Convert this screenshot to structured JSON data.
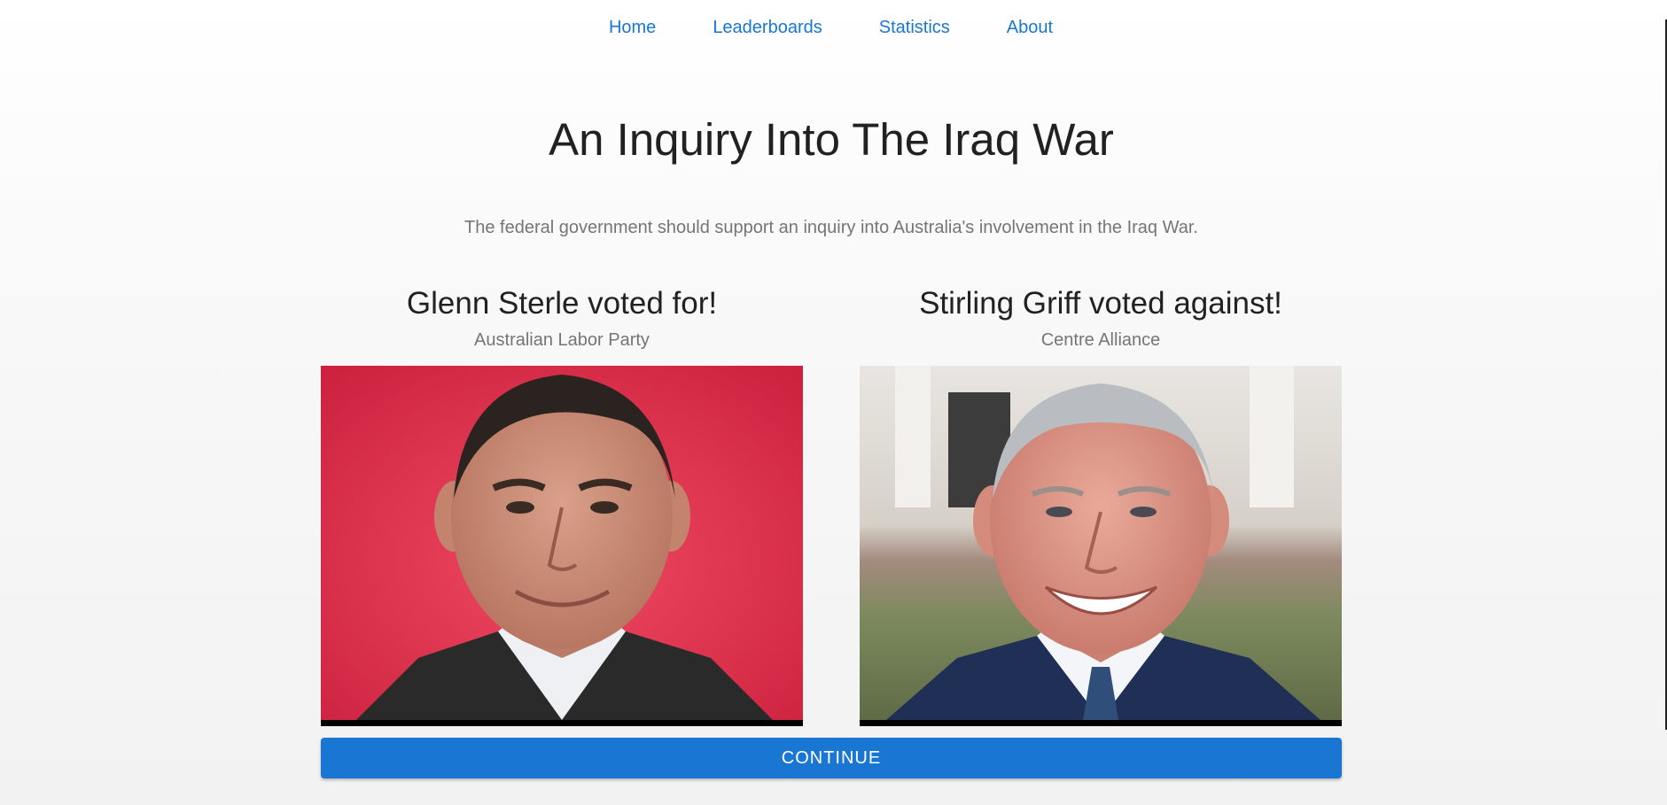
{
  "nav": {
    "items": [
      {
        "label": "Home"
      },
      {
        "label": "Leaderboards"
      },
      {
        "label": "Statistics"
      },
      {
        "label": "About"
      }
    ]
  },
  "vote": {
    "title": "An Inquiry Into The Iraq War",
    "question": "The federal government should support an inquiry into Australia's involvement in the Iraq War."
  },
  "politicians": [
    {
      "heading": "Glenn Sterle voted for!",
      "party": "Australian Labor Party"
    },
    {
      "heading": "Stirling Griff voted against!",
      "party": "Centre Alliance"
    }
  ],
  "actions": {
    "continue_label": "CONTINUE"
  },
  "colors": {
    "accent": "#1976d2",
    "text": "#212121",
    "muted": "#757575"
  }
}
